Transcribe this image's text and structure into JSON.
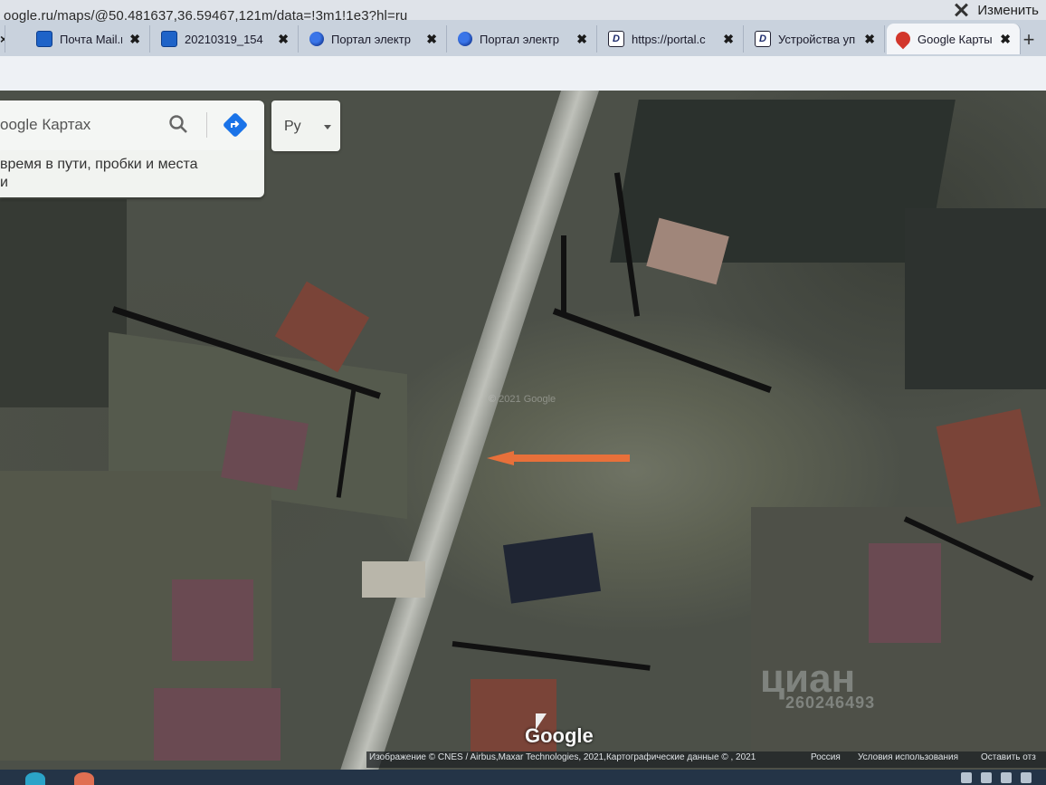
{
  "window": {
    "change_label": "Изменить"
  },
  "tabs": [
    {
      "label": "Почта Mail.ru",
      "icon": "mail-icon"
    },
    {
      "label": "20210319_154",
      "icon": "mail-icon"
    },
    {
      "label": "Портал электр",
      "icon": "globe-icon"
    },
    {
      "label": "Портал электр",
      "icon": "globe-icon"
    },
    {
      "label": "https://portal.c",
      "icon": "d-logo-icon"
    },
    {
      "label": "Устройства уп",
      "icon": "d-logo-icon"
    },
    {
      "label": "Google Карты",
      "icon": "map-pin-icon",
      "active": true
    }
  ],
  "address": {
    "url": "oogle.ru/maps/@50.481637,36.59467,121m/data=!3m1!1e3?hl=ru"
  },
  "search": {
    "placeholder": "oogle Картах",
    "hint_line1": "время в пути, пробки и места",
    "hint_line2": "и"
  },
  "language_button": {
    "label": "Ру"
  },
  "map": {
    "google_logo": "Google",
    "attribution": "Изображение © CNES / Airbus,Maxar Technologies, 2021,Картографические данные © , 2021",
    "country": "Россия",
    "terms": "Условия использования",
    "feedback": "Оставить отз",
    "watermark_brand": "циан",
    "watermark_id": "260246493",
    "faint_watermark": "© 2021 Google",
    "arrow_color": "#e8703a"
  }
}
